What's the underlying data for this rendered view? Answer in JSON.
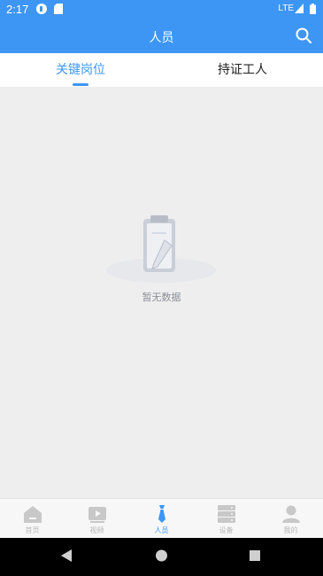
{
  "status_bar": {
    "time": "2:17",
    "network": "LTE"
  },
  "header": {
    "title": "人员"
  },
  "tabs": [
    {
      "label": "关键岗位",
      "active": true
    },
    {
      "label": "持证工人",
      "active": false
    }
  ],
  "empty_state": {
    "message": "暂无数据"
  },
  "bottom_nav": [
    {
      "label": "首页",
      "icon": "home-icon",
      "active": false
    },
    {
      "label": "视频",
      "icon": "video-icon",
      "active": false
    },
    {
      "label": "人员",
      "icon": "tie-icon",
      "active": true
    },
    {
      "label": "设备",
      "icon": "server-icon",
      "active": false
    },
    {
      "label": "我的",
      "icon": "user-icon",
      "active": false
    }
  ],
  "colors": {
    "primary": "#3d96f4",
    "inactive": "#b9b9b9",
    "background": "#eeeeee"
  }
}
